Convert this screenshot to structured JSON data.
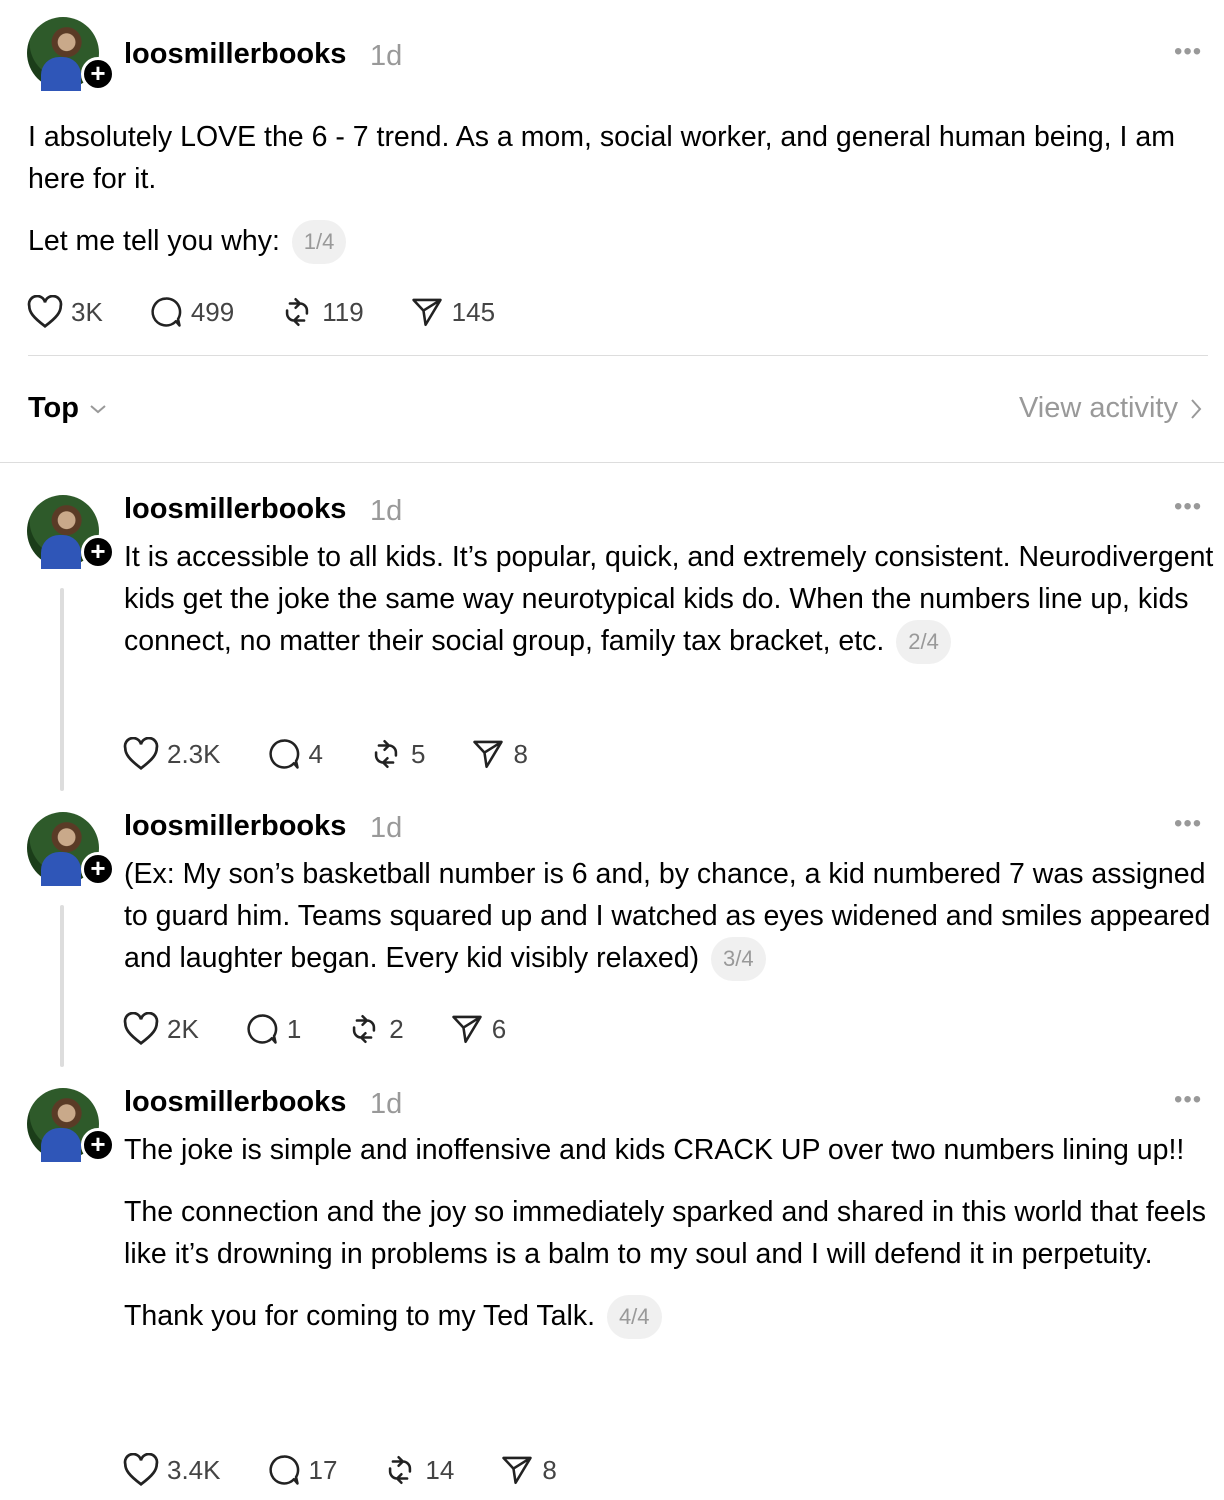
{
  "main_post": {
    "username": "loosmillerbooks",
    "time": "1d",
    "paragraphs": [
      "I absolutely LOVE the 6 - 7 trend. As a mom, social worker, and general human being, I am here for it.",
      "Let me tell you why:"
    ],
    "counter": "1/4",
    "likes": "3K",
    "replies": "499",
    "reposts": "119",
    "shares": "145"
  },
  "sort": {
    "label": "Top",
    "view_activity": "View activity"
  },
  "replies": [
    {
      "username": "loosmillerbooks",
      "time": "1d",
      "paragraphs": [
        "It is accessible to all kids. It’s popular, quick, and extremely consistent. Neurodivergent kids get the joke the same way neurotypical kids do. When the numbers line up, kids connect, no matter their social group, family tax bracket, etc."
      ],
      "counter": "2/4",
      "likes": "2.3K",
      "replies": "4",
      "reposts": "5",
      "shares": "8"
    },
    {
      "username": "loosmillerbooks",
      "time": "1d",
      "paragraphs": [
        "(Ex: My son’s basketball number is 6 and, by chance, a kid numbered 7 was assigned to guard him. Teams squared up and I watched as eyes widened and smiles appeared and laughter began. Every kid visibly relaxed)"
      ],
      "counter": "3/4",
      "likes": "2K",
      "replies": "1",
      "reposts": "2",
      "shares": "6"
    },
    {
      "username": "loosmillerbooks",
      "time": "1d",
      "paragraphs": [
        "The joke is simple and inoffensive and kids CRACK UP over two numbers lining up!!",
        "The connection and the joy so immediately sparked and shared in this world that feels like it’s drowning in problems is a balm to my soul and I will defend it in perpetuity.",
        "Thank you for coming to my Ted Talk."
      ],
      "counter": "4/4",
      "likes": "3.4K",
      "replies": "17",
      "reposts": "14",
      "shares": "8"
    }
  ]
}
